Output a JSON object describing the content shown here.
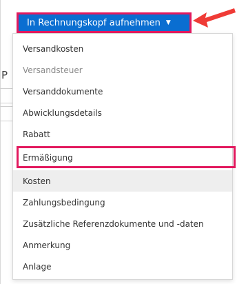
{
  "background": {
    "partial_letter": "P"
  },
  "trigger": {
    "label": "In Rechnungskopf aufnehmen",
    "caret": "▼",
    "color": "#0a6ed1"
  },
  "menu": {
    "items": [
      {
        "label": "Versandkosten",
        "state": "enabled"
      },
      {
        "label": "Versandsteuer",
        "state": "disabled"
      },
      {
        "label": "Versanddokumente",
        "state": "enabled"
      },
      {
        "label": "Abwicklungsdetails",
        "state": "enabled"
      },
      {
        "label": "Rabatt",
        "state": "enabled"
      },
      {
        "label": "Ermäßigung",
        "state": "highlighted"
      },
      {
        "label": "Kosten",
        "state": "hovered"
      },
      {
        "label": "Zahlungsbedingung",
        "state": "enabled"
      },
      {
        "label": "Zusätzliche Referenzdokumente und -daten",
        "state": "enabled"
      },
      {
        "label": "Anmerkung",
        "state": "enabled"
      },
      {
        "label": "Anlage",
        "state": "enabled"
      }
    ]
  },
  "annotations": {
    "highlight_color": "#e2195e",
    "arrow_color": "#ef3b36"
  }
}
